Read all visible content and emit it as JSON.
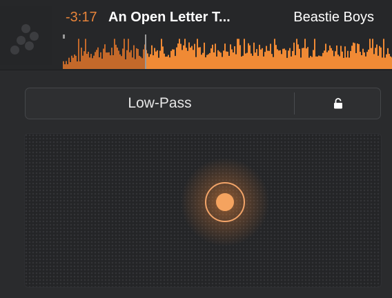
{
  "track": {
    "remaining_time": "-3:17",
    "title": "An Open Letter T...",
    "artist": "Beastie Boys",
    "artwork_icon": "album-artwork"
  },
  "waveform": {
    "played_fraction": 0.25,
    "played_color": "#c4692a",
    "unplayed_color": "#f08a35",
    "playhead_color": "#9a9a9a"
  },
  "filter": {
    "name": "Low-Pass",
    "lock_icon": "unlock-icon"
  },
  "xy_pad": {
    "handle_x": 0.56,
    "handle_y": 0.44,
    "accent": "#e8843a"
  }
}
